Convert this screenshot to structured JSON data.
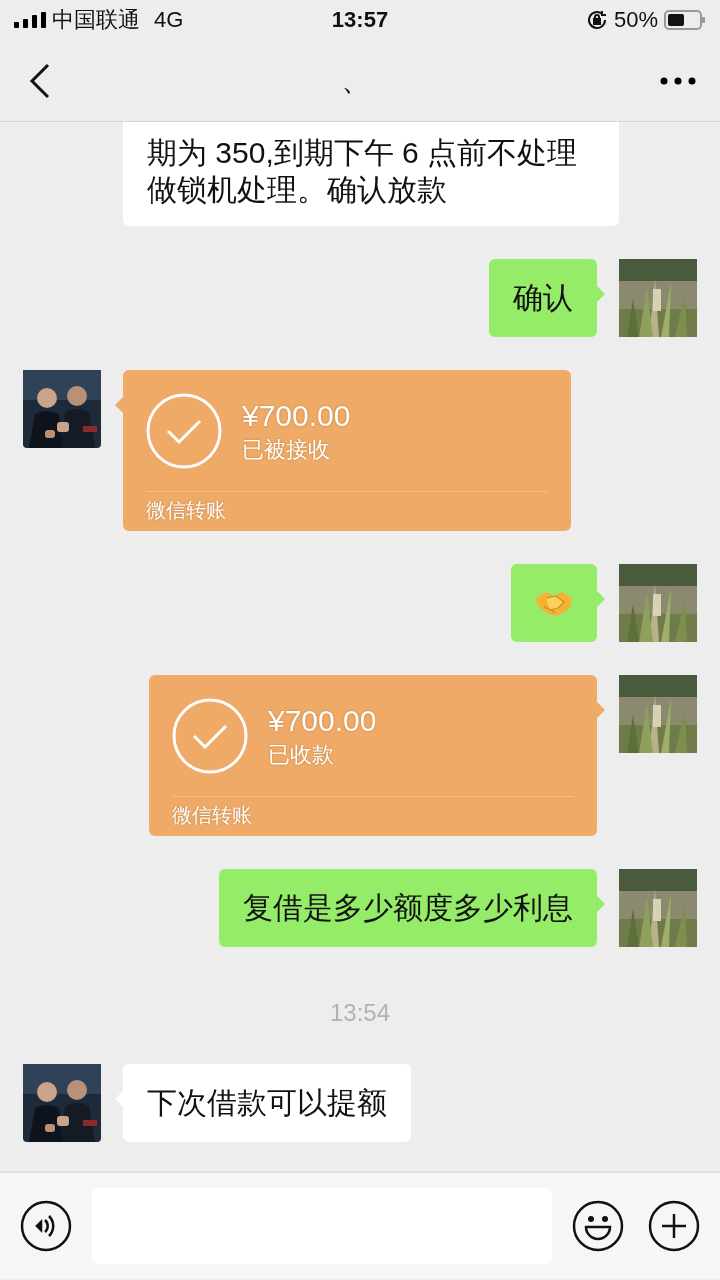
{
  "status_bar": {
    "carrier": "中国联通",
    "network": "4G",
    "time": "13:57",
    "battery": "50%"
  },
  "nav": {
    "title": "、"
  },
  "messages": [
    {
      "kind": "text",
      "outgoing": false,
      "cut_top": true,
      "text": "期为 350,到期下午 6 点前不处理做锁机处理。确认放款"
    },
    {
      "kind": "text",
      "outgoing": true,
      "text": "确认"
    },
    {
      "kind": "transfer",
      "outgoing": false,
      "amount": "¥700.00",
      "status": "已被接收",
      "footer": "微信转账"
    },
    {
      "kind": "emoji",
      "outgoing": true
    },
    {
      "kind": "transfer",
      "outgoing": true,
      "amount": "¥700.00",
      "status": "已收款",
      "footer": "微信转账"
    },
    {
      "kind": "text",
      "outgoing": true,
      "text": "复借是多少额度多少利息"
    },
    {
      "kind": "time",
      "text": "13:54"
    },
    {
      "kind": "text",
      "outgoing": false,
      "text": "下次借款可以提额"
    }
  ]
}
